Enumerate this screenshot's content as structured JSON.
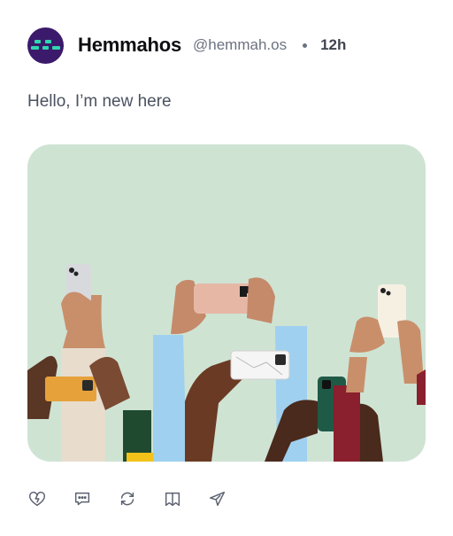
{
  "post": {
    "author_name": "Hemmahos",
    "handle": "@hemmah.os",
    "time": "12h",
    "text": "Hello, I’m new here"
  },
  "actions": [
    {
      "name": "like",
      "icon": "heart-icon"
    },
    {
      "name": "comment",
      "icon": "comment-icon"
    },
    {
      "name": "repost",
      "icon": "repost-icon"
    },
    {
      "name": "bookmark",
      "icon": "bookmark-icon"
    },
    {
      "name": "share",
      "icon": "send-icon"
    }
  ],
  "colors": {
    "avatar_bg": "#3b1a6b",
    "avatar_accent": "#2fd8b0",
    "media_bg": "#cfe3d3",
    "icon": "#5b6170"
  }
}
